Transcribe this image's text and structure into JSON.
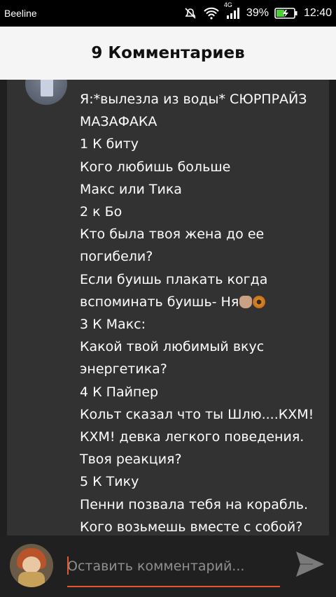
{
  "status_bar": {
    "carrier": "Beeline",
    "network": "4G",
    "battery": "39%",
    "time": "12:40"
  },
  "header": {
    "title": "9 Комментариев"
  },
  "comment": {
    "lines": [
      "Я:*вылезла из воды* СЮРПРАЙЗ",
      "МАЗАФАКА",
      "1 К биту",
      "Кого любишь больше",
      "Макс или Тика",
      "2 к Бо",
      "Кто была твоя жена до ее",
      "погибели?",
      "Если буишь плакать когда",
      "вспоминать буишь- Ня",
      "3 К Макс:",
      "Какой твой любимый вкус",
      "энергетика?",
      "4 К Пайпер",
      "Кольт сказал что ты Шлю....КХМ!",
      "КХМ! девка легкого поведения.",
      "Твоя реакция?",
      "5 К Тику",
      "Пенни позвала тебя на корабль.",
      "Кого возьмешь вместе с собой?"
    ],
    "emoji_icons": [
      "coffee-hand-emoji",
      "donut-emoji"
    ]
  },
  "composer": {
    "placeholder": "Оставить комментарий...",
    "accent_color": "#e4572e"
  }
}
